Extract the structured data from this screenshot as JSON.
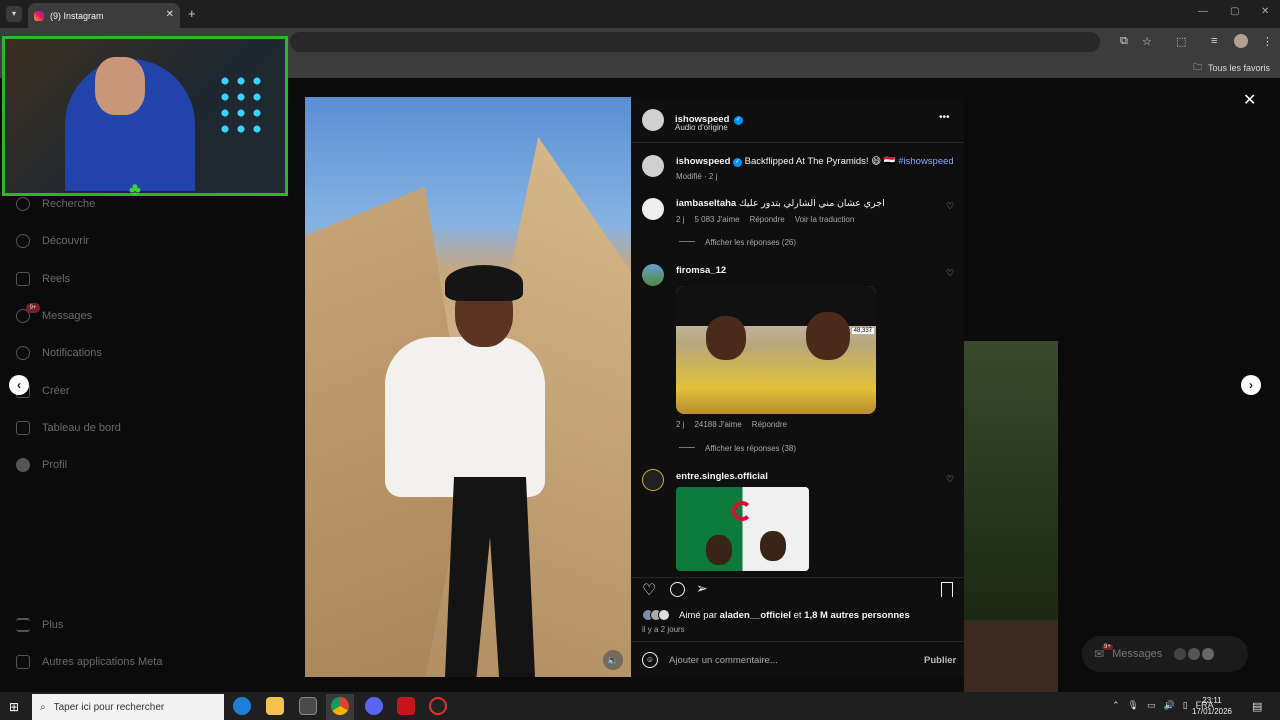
{
  "browser": {
    "tab_title": "(9) Instagram",
    "tab_close": "✕",
    "new_tab": "+",
    "bookmarks_folder": "Tous les favoris"
  },
  "sidebar": {
    "items": [
      {
        "label": "Recherche",
        "icon": "search-icon"
      },
      {
        "label": "Découvrir",
        "icon": "compass-icon"
      },
      {
        "label": "Reels",
        "icon": "reels-icon"
      },
      {
        "label": "Messages",
        "icon": "messenger-icon",
        "badge": "9+"
      },
      {
        "label": "Notifications",
        "icon": "heart-icon"
      },
      {
        "label": "Créer",
        "icon": "plus-icon"
      },
      {
        "label": "Tableau de bord",
        "icon": "chart-icon"
      },
      {
        "label": "Profil",
        "icon": "profile-icon"
      },
      {
        "label": "Plus",
        "icon": "menu-icon"
      },
      {
        "label": "Autres applications Meta",
        "icon": "meta-icon"
      }
    ]
  },
  "post": {
    "author": "ishowspeed",
    "audio": "Audio d'origine",
    "more": "•••",
    "caption_author": "ishowspeed",
    "caption_text": "Backflipped At The Pyramids! 😄 🇪🇬",
    "caption_tag": "#ishowspeed",
    "caption_meta": "Modifié · 2 j",
    "comments": [
      {
        "user": "iambaseltaha",
        "text": "اجري عشان مني الشارلي بتدور عليك",
        "age": "2 j",
        "likes": "5 083 J'aime",
        "reply": "Répondre",
        "translate": "Voir la traduction",
        "replies": "Afficher les réponses (26)"
      },
      {
        "user": "firomsa_12",
        "overlay": "48,337",
        "age": "2 j",
        "likes": "24188 J'aime",
        "reply": "Répondre",
        "replies": "Afficher les réponses (38)"
      },
      {
        "user": "entre.singles.official"
      }
    ],
    "liked_by_prefix": "Aimé par",
    "liked_by_user": "aladen__officiel",
    "liked_by_mid": "et",
    "liked_by_others": "1,8 M autres personnes",
    "posted": "il y a 2 jours",
    "comment_placeholder": "Ajouter un commentaire...",
    "publish": "Publier"
  },
  "widget": {
    "messages_label": "Messages",
    "messages_badge": "9+"
  },
  "taskbar": {
    "search_placeholder": "Taper ici pour rechercher",
    "lang": "FRA",
    "time": "23:11",
    "date": "17/01/2026"
  }
}
